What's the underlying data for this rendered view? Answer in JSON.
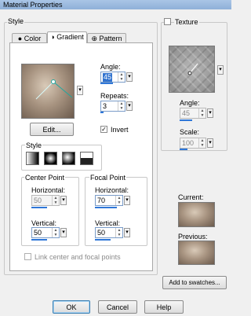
{
  "window": {
    "title": "Material Properties"
  },
  "style_group": {
    "label": "Style"
  },
  "tabs": [
    {
      "label": "Color"
    },
    {
      "label": "Gradient"
    },
    {
      "label": "Pattern"
    }
  ],
  "gradient": {
    "angle_label": "Angle:",
    "angle_value": "45",
    "repeats_label": "Repeats:",
    "repeats_value": "3",
    "edit_label": "Edit...",
    "invert_label": "Invert",
    "invert_checked": true,
    "style_label": "Style",
    "styles": [
      "linear",
      "rectangular",
      "sunburst",
      "radial"
    ]
  },
  "center_point": {
    "label": "Center Point",
    "horizontal_label": "Horizontal:",
    "horizontal_value": "50",
    "vertical_label": "Vertical:",
    "vertical_value": "50"
  },
  "focal_point": {
    "label": "Focal Point",
    "horizontal_label": "Horizontal:",
    "horizontal_value": "70",
    "vertical_label": "Vertical:",
    "vertical_value": "50"
  },
  "link_label": "Link center and focal points",
  "texture": {
    "label": "Texture",
    "checked": false,
    "angle_label": "Angle:",
    "angle_value": "45",
    "scale_label": "Scale:",
    "scale_value": "100"
  },
  "current_label": "Current:",
  "previous_label": "Previous:",
  "add_swatches_label": "Add to swatches...",
  "buttons": {
    "ok": "OK",
    "cancel": "Cancel",
    "help": "Help"
  },
  "colors": {
    "accent": "#2f77d8",
    "gradient_light": "#d9cab8",
    "gradient_dark": "#6b5a4c"
  }
}
